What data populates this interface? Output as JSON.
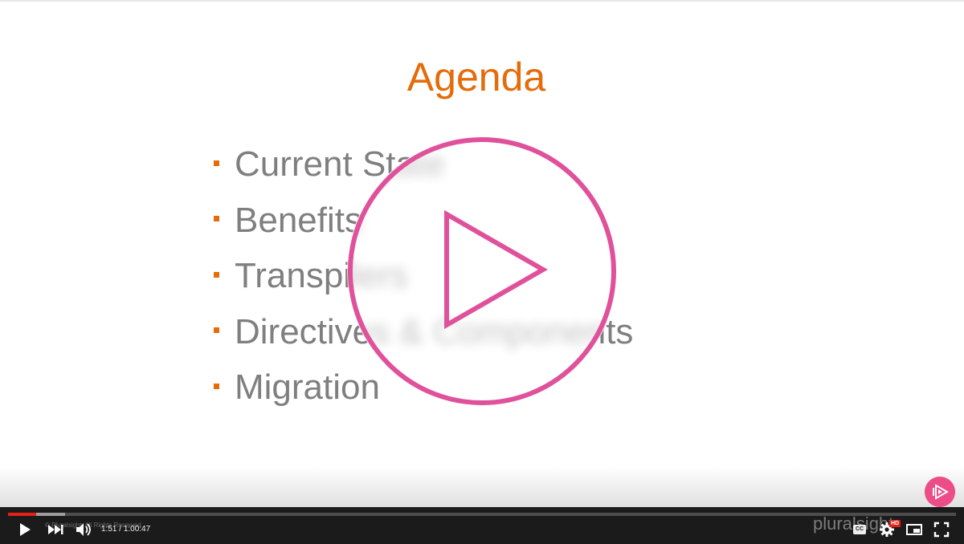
{
  "slide": {
    "title": "Agenda",
    "items": [
      "Current State",
      "Benefits",
      "Transpilers",
      "Directives & Components",
      "Migration"
    ]
  },
  "player": {
    "current_time": "1:51",
    "separator": " / ",
    "duration": "1:00:47",
    "played_fraction": 0.03,
    "buffered_fraction": 0.06,
    "copyright": "© Pluralsight. All Rights Reserved.",
    "watermark": "pluralsight",
    "cc_label": "CC",
    "hd_label": "HD"
  },
  "icons": {
    "big_play": "play-circle-icon",
    "play": "play-icon",
    "next": "next-icon",
    "volume": "volume-icon",
    "cc": "cc-icon",
    "settings": "gear-icon",
    "miniplayer": "miniplayer-icon",
    "fullscreen": "fullscreen-icon",
    "brand": "pluralsight-logo-icon"
  },
  "colors": {
    "title": "#e46c0a",
    "bullet": "#e46c0a",
    "item_text": "#7f7f7f",
    "play_ring": "#e0519b",
    "progress_played": "#e52117",
    "control_bar": "#1b1b1b"
  }
}
